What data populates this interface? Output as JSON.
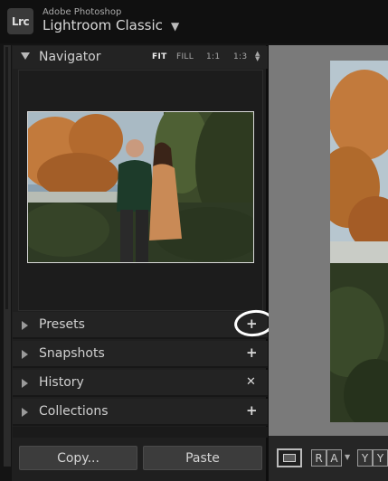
{
  "app": {
    "vendor": "Adobe Photoshop",
    "name": "Lightroom Classic",
    "logo": "Lrc",
    "menu_icon": "triangle-down-icon"
  },
  "navigator": {
    "title": "Navigator",
    "zoom_options": [
      "FIT",
      "FILL",
      "1:1",
      "1:3"
    ],
    "active_zoom": "FIT"
  },
  "sections": [
    {
      "label": "Presets",
      "action_icon": "plus-icon",
      "action_glyph": "+",
      "highlighted": true
    },
    {
      "label": "Snapshots",
      "action_icon": "plus-icon",
      "action_glyph": "+"
    },
    {
      "label": "History",
      "action_icon": "clear-icon",
      "action_glyph": "✕"
    },
    {
      "label": "Collections",
      "action_icon": "plus-icon",
      "action_glyph": "+"
    }
  ],
  "buttons": {
    "copy": "Copy...",
    "paste": "Paste"
  },
  "toolbar": {
    "compare_left": "R",
    "compare_right": "A",
    "survey_left": "Y",
    "survey_right": "Y"
  },
  "colors": {
    "panel_bg": "#1f1f1f",
    "header_bg": "#232323",
    "annotation_circle": "#ffffff"
  }
}
